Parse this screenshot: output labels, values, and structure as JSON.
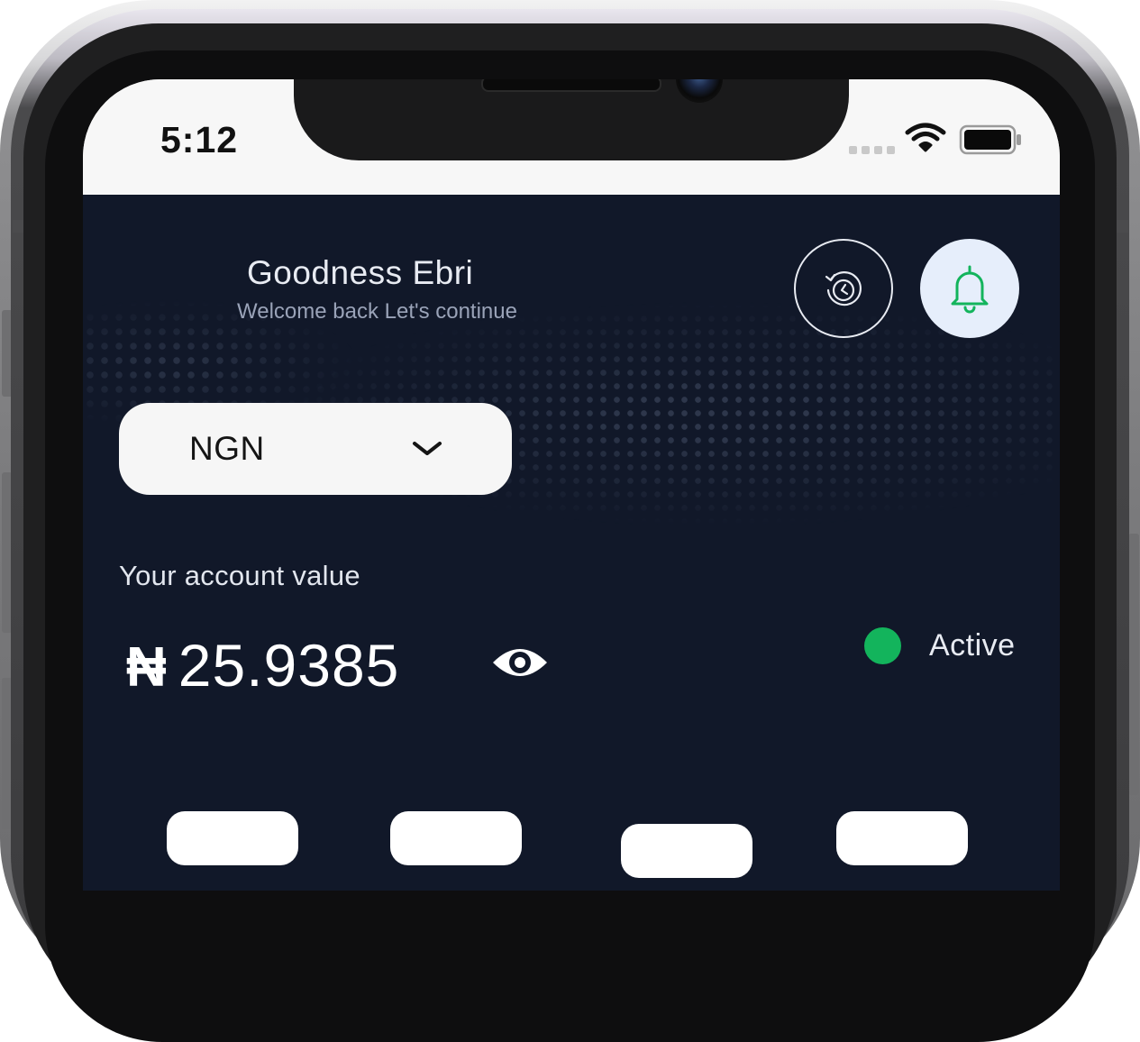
{
  "status_bar": {
    "time": "5:12",
    "icons": [
      "cellular-signal-icon",
      "wifi-icon",
      "battery-icon"
    ]
  },
  "header": {
    "user_name": "Goodness Ebri",
    "welcome_text": "Welcome back Let's continue",
    "buttons": [
      {
        "name": "history-button",
        "icon": "history-clock-icon"
      },
      {
        "name": "notifications-button",
        "icon": "bell-icon"
      }
    ]
  },
  "currency_select": {
    "value": "NGN",
    "icon": "chevron-down-icon"
  },
  "account": {
    "label": "Your account value",
    "currency_symbol": "₦",
    "amount": "25.9385",
    "visibility_icon": "eye-icon",
    "status": "Active",
    "status_color": "#13b45c"
  },
  "colors": {
    "app_background": "#111829",
    "bell_button_background": "#e6eefb",
    "bell_icon": "#13b45c",
    "select_background": "#f6f6f6"
  },
  "quick_actions": [
    {
      "name": "quick-action-1",
      "label": ""
    },
    {
      "name": "quick-action-2",
      "label": ""
    },
    {
      "name": "quick-action-3",
      "label": ""
    },
    {
      "name": "quick-action-4",
      "label": ""
    }
  ]
}
